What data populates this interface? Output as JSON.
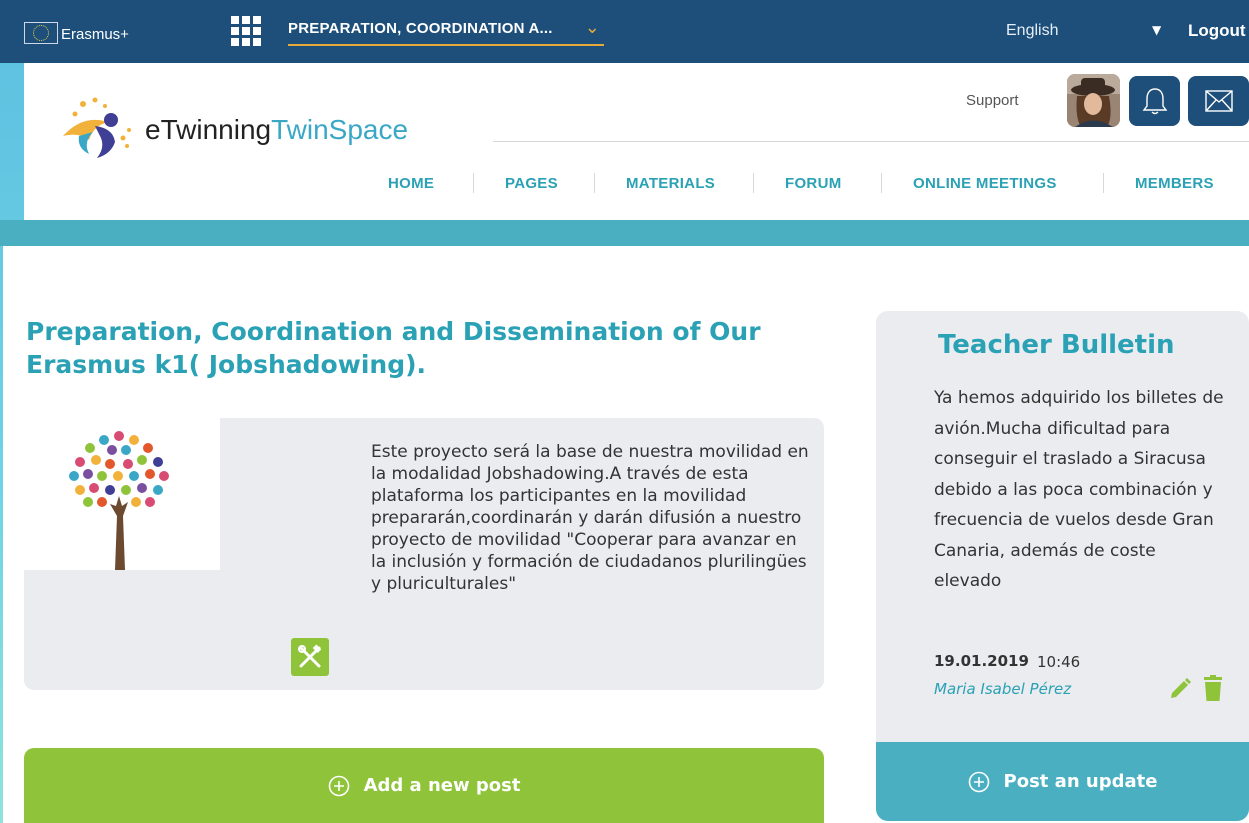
{
  "topbar": {
    "brand": "Erasmus+",
    "project_selector": "PREPARATION, COORDINATION A...",
    "language": "English",
    "logout": "Logout"
  },
  "header": {
    "logo_e": "eTwinning",
    "logo_twin": "TwinSpace",
    "support": "Support",
    "nav": [
      "HOME",
      "PAGES",
      "MATERIALS",
      "FORUM",
      "ONLINE MEETINGS",
      "MEMBERS"
    ]
  },
  "main": {
    "title": "Preparation, Coordination and Dissemination of Our Erasmus k1( Jobshadowing).",
    "description": "Este proyecto será la base de nuestra movilidad en la modalidad Jobshadowing.A través de esta plataforma los participantes en la movilidad prepararán,coordinarán y darán difusión a nuestro proyecto de movilidad \"Cooperar para avanzar en la inclusión y formación de ciudadanos plurilingües y pluriculturales\"",
    "add_post": "Add a new post"
  },
  "bulletin": {
    "title": "Teacher Bulletin",
    "text": "Ya hemos adquirido los billetes de avión.Mucha dificultad para conseguir el traslado a Siracusa debido a las poca combinación y frecuencia de vuelos desde Gran Canaria, además de coste elevado",
    "date": "19.01.2019",
    "time": "10:46",
    "author": "Maria Isabel Pérez",
    "post_update": "Post an update"
  },
  "colors": {
    "topbar": "#1d4f7a",
    "teal": "#4aafc1",
    "title_teal": "#2aa1b4",
    "green": "#8fc33a",
    "card_grey": "#eaecf0",
    "accent_orange": "#e8a93b"
  }
}
